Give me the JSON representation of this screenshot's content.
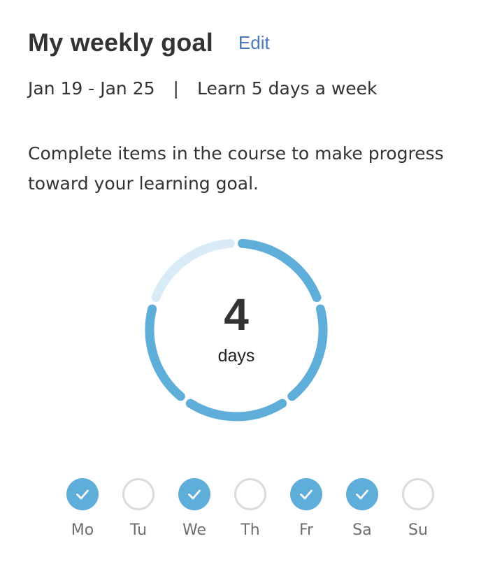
{
  "header": {
    "title": "My weekly goal",
    "edit_label": "Edit"
  },
  "meta": {
    "date_range": "Jan 19 - Jan 25",
    "separator": "|",
    "goal_text": "Learn 5 days a week"
  },
  "description": "Complete items in the course to make progress toward your learning goal.",
  "progress": {
    "count": "4",
    "unit": "days",
    "completed": 4,
    "goal": 5
  },
  "days": [
    {
      "label": "Mo",
      "done": true
    },
    {
      "label": "Tu",
      "done": false
    },
    {
      "label": "We",
      "done": true
    },
    {
      "label": "Th",
      "done": false
    },
    {
      "label": "Fr",
      "done": true
    },
    {
      "label": "Sa",
      "done": true
    },
    {
      "label": "Su",
      "done": false
    }
  ],
  "colors": {
    "accent": "#5faed9",
    "accent_light": "#d9ebf6",
    "link": "#4a79c0",
    "inactive_border": "#dcdcdc"
  }
}
